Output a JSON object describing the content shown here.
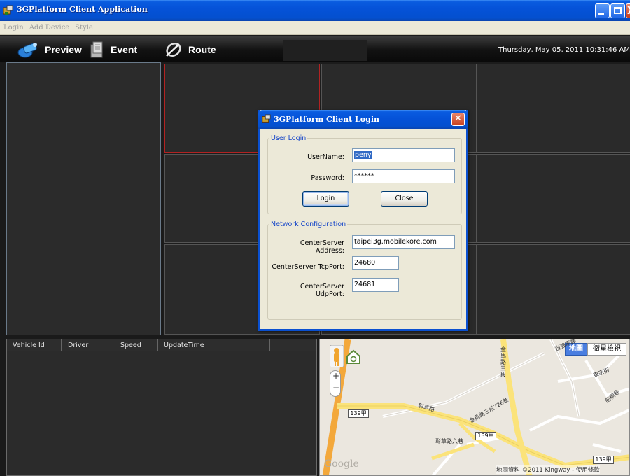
{
  "window": {
    "title": "3GPlatform Client Application",
    "controls": {
      "minimize": "_",
      "maximize": "□",
      "close": "X"
    }
  },
  "menu": [
    "Login",
    "Add Device",
    "Style"
  ],
  "toolbar": {
    "preview_label": "Preview",
    "event_label": "Event",
    "route_label": "Route",
    "datetime": "Thursday, May 05, 2011 10:31:46 AM"
  },
  "vehicle_table": {
    "columns": [
      "Vehicle Id",
      "Driver",
      "Speed",
      "UpdateTime"
    ],
    "rows": []
  },
  "map": {
    "controls": {
      "zoom_in": "+",
      "zoom_out": "−"
    },
    "map_type_buttons": [
      "地圖",
      "衛星檢視"
    ],
    "road_shields": [
      "139甲",
      "139甲",
      "139甲"
    ],
    "place_labels": [
      "金馬路三段",
      "彰草路",
      "金馬路三段726巷",
      "東宗街",
      "彰草路六巷",
      "自強南路",
      "莿桐巷"
    ],
    "attribution": "地圖資料 ©2011 Kingway - 使用條款",
    "logo": "Google"
  },
  "login_dialog": {
    "title": "3GPlatform Client Login",
    "close_label": "✕",
    "user_login_group": "User Login",
    "username_label": "UserName:",
    "username_value": "peny",
    "password_label": "Password:",
    "password_value": "******",
    "login_button": "Login",
    "close_button": "Close",
    "network_group": "Network Configuration",
    "server_address_label": "CenterServer Address:",
    "server_address_value": "taipei3g.mobilekore.com",
    "tcp_port_label": "CenterServer TcpPort:",
    "tcp_port_value": "24680",
    "udp_port_label": "CenterServer UdpPort:",
    "udp_port_value": "24681"
  },
  "colors": {
    "titlebar_blue": "#0552d8",
    "active_cell_border": "#b22222",
    "group_legend": "#1545c8"
  }
}
